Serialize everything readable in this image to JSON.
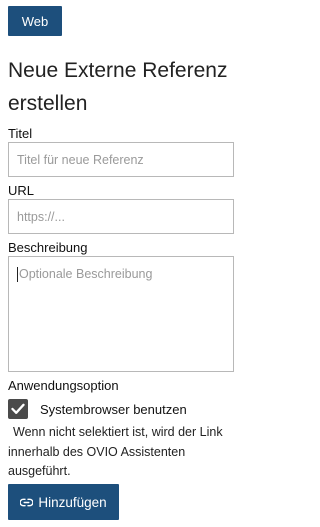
{
  "tag_button": {
    "label": "Web"
  },
  "page": {
    "title": "Neue Externe Referenz erstellen"
  },
  "form": {
    "title_field": {
      "label": "Titel",
      "placeholder": "Titel für neue Referenz",
      "value": ""
    },
    "url_field": {
      "label": "URL",
      "placeholder": "https://...",
      "value": ""
    },
    "description_field": {
      "label": "Beschreibung",
      "placeholder": "Optionale Beschreibung",
      "value": ""
    },
    "app_option": {
      "label": "Anwendungsoption",
      "checkbox_label": "Systembrowser benutzen",
      "checked": true,
      "hint": "Wenn nicht selektiert ist, wird der Link innerhalb des OVIO Assistenten ausgeführt."
    },
    "submit": {
      "label": "Hinzufügen",
      "icon": "link-icon"
    }
  },
  "colors": {
    "primary": "#1d4f7c",
    "checkbox": "#4a4a4a",
    "border": "#b8b8b8"
  }
}
